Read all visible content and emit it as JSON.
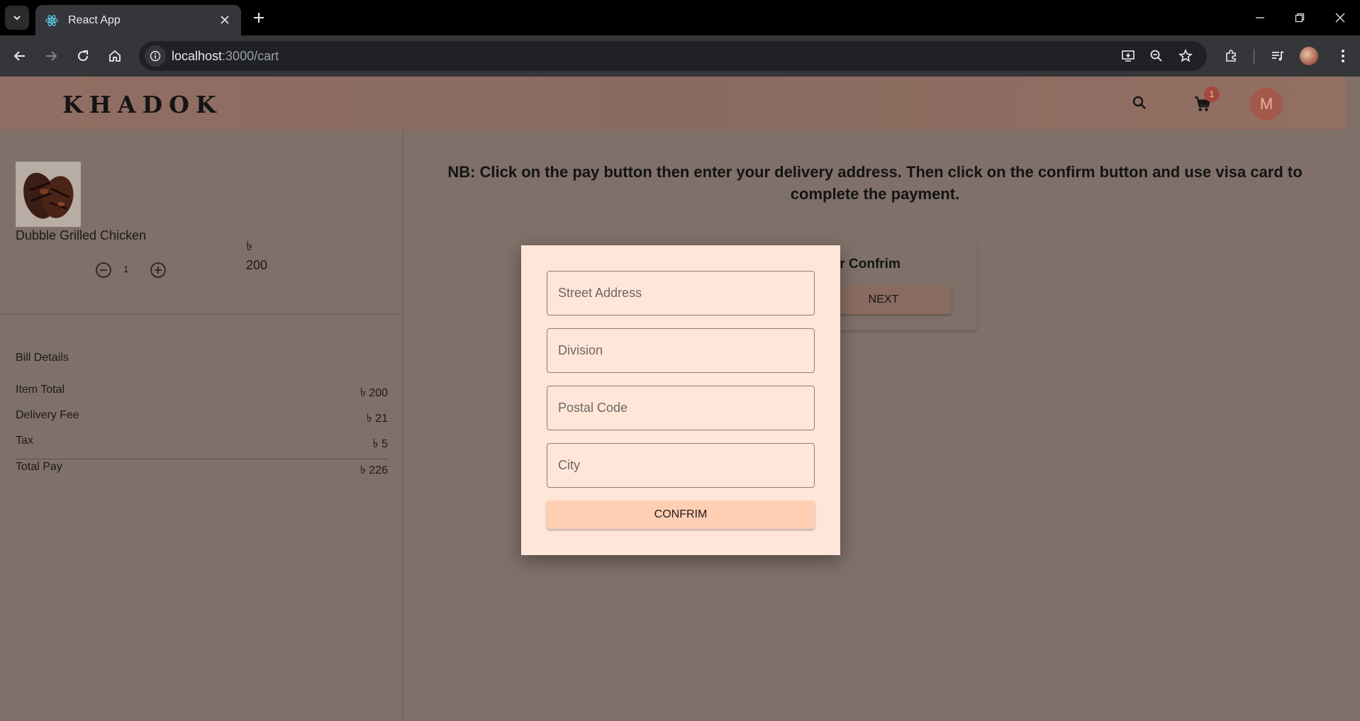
{
  "browser": {
    "tab_title": "React App",
    "url_host": "localhost",
    "url_path": ":3000/cart"
  },
  "header": {
    "logo": "KHADOK",
    "cart_badge": "1",
    "avatar_letter": "M"
  },
  "cart_item": {
    "name": "Dubble Grilled Chicken",
    "currency": "৳",
    "price": "200",
    "quantity": "1"
  },
  "bill": {
    "title": "Bill Details",
    "rows": [
      {
        "label": "Item Total",
        "value": "৳ 200"
      },
      {
        "label": "Delivery Fee",
        "value": "৳ 21"
      },
      {
        "label": "Tax",
        "value": "৳ 5"
      },
      {
        "label": "Total Pay",
        "value": "৳ 226"
      }
    ]
  },
  "notice": "NB: Click on the pay button then enter your delivery address. Then click on the confirm button and use visa card to complete the payment.",
  "stepper": {
    "title": "Order Confrim",
    "next_label": "NEXT"
  },
  "modal": {
    "street_placeholder": "Street Address",
    "division_placeholder": "Division",
    "postal_placeholder": "Postal Code",
    "city_placeholder": "City",
    "confirm_label": "CONFRIM"
  },
  "colors": {
    "modal_bg": "#ffe6d9",
    "confirm_bg": "#ffceb3",
    "avatar_bg": "#a4574b"
  }
}
